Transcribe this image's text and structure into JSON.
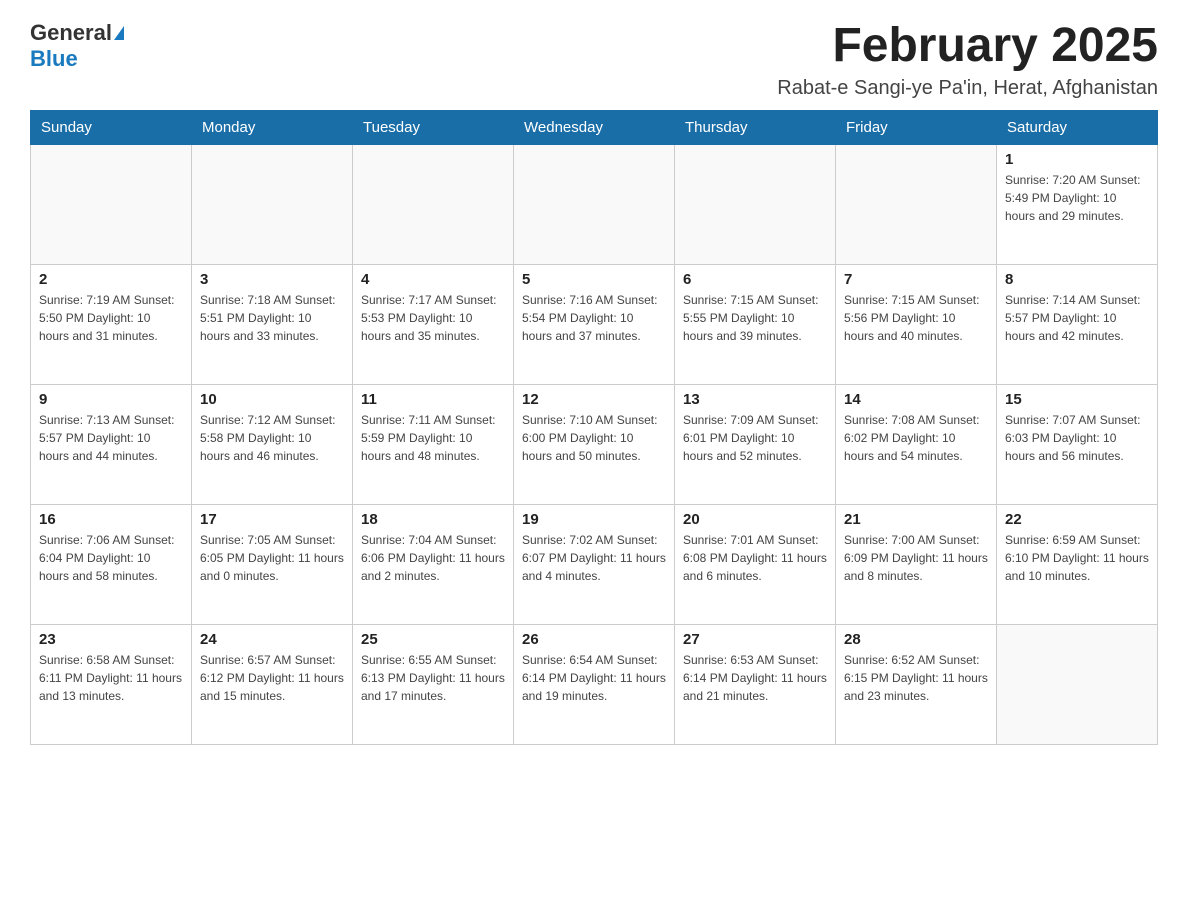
{
  "logo": {
    "general": "General",
    "blue": "Blue"
  },
  "header": {
    "month_year": "February 2025",
    "location": "Rabat-e Sangi-ye Pa'in, Herat, Afghanistan"
  },
  "weekdays": [
    "Sunday",
    "Monday",
    "Tuesday",
    "Wednesday",
    "Thursday",
    "Friday",
    "Saturday"
  ],
  "weeks": [
    [
      {
        "day": "",
        "info": ""
      },
      {
        "day": "",
        "info": ""
      },
      {
        "day": "",
        "info": ""
      },
      {
        "day": "",
        "info": ""
      },
      {
        "day": "",
        "info": ""
      },
      {
        "day": "",
        "info": ""
      },
      {
        "day": "1",
        "info": "Sunrise: 7:20 AM\nSunset: 5:49 PM\nDaylight: 10 hours and 29 minutes."
      }
    ],
    [
      {
        "day": "2",
        "info": "Sunrise: 7:19 AM\nSunset: 5:50 PM\nDaylight: 10 hours and 31 minutes."
      },
      {
        "day": "3",
        "info": "Sunrise: 7:18 AM\nSunset: 5:51 PM\nDaylight: 10 hours and 33 minutes."
      },
      {
        "day": "4",
        "info": "Sunrise: 7:17 AM\nSunset: 5:53 PM\nDaylight: 10 hours and 35 minutes."
      },
      {
        "day": "5",
        "info": "Sunrise: 7:16 AM\nSunset: 5:54 PM\nDaylight: 10 hours and 37 minutes."
      },
      {
        "day": "6",
        "info": "Sunrise: 7:15 AM\nSunset: 5:55 PM\nDaylight: 10 hours and 39 minutes."
      },
      {
        "day": "7",
        "info": "Sunrise: 7:15 AM\nSunset: 5:56 PM\nDaylight: 10 hours and 40 minutes."
      },
      {
        "day": "8",
        "info": "Sunrise: 7:14 AM\nSunset: 5:57 PM\nDaylight: 10 hours and 42 minutes."
      }
    ],
    [
      {
        "day": "9",
        "info": "Sunrise: 7:13 AM\nSunset: 5:57 PM\nDaylight: 10 hours and 44 minutes."
      },
      {
        "day": "10",
        "info": "Sunrise: 7:12 AM\nSunset: 5:58 PM\nDaylight: 10 hours and 46 minutes."
      },
      {
        "day": "11",
        "info": "Sunrise: 7:11 AM\nSunset: 5:59 PM\nDaylight: 10 hours and 48 minutes."
      },
      {
        "day": "12",
        "info": "Sunrise: 7:10 AM\nSunset: 6:00 PM\nDaylight: 10 hours and 50 minutes."
      },
      {
        "day": "13",
        "info": "Sunrise: 7:09 AM\nSunset: 6:01 PM\nDaylight: 10 hours and 52 minutes."
      },
      {
        "day": "14",
        "info": "Sunrise: 7:08 AM\nSunset: 6:02 PM\nDaylight: 10 hours and 54 minutes."
      },
      {
        "day": "15",
        "info": "Sunrise: 7:07 AM\nSunset: 6:03 PM\nDaylight: 10 hours and 56 minutes."
      }
    ],
    [
      {
        "day": "16",
        "info": "Sunrise: 7:06 AM\nSunset: 6:04 PM\nDaylight: 10 hours and 58 minutes."
      },
      {
        "day": "17",
        "info": "Sunrise: 7:05 AM\nSunset: 6:05 PM\nDaylight: 11 hours and 0 minutes."
      },
      {
        "day": "18",
        "info": "Sunrise: 7:04 AM\nSunset: 6:06 PM\nDaylight: 11 hours and 2 minutes."
      },
      {
        "day": "19",
        "info": "Sunrise: 7:02 AM\nSunset: 6:07 PM\nDaylight: 11 hours and 4 minutes."
      },
      {
        "day": "20",
        "info": "Sunrise: 7:01 AM\nSunset: 6:08 PM\nDaylight: 11 hours and 6 minutes."
      },
      {
        "day": "21",
        "info": "Sunrise: 7:00 AM\nSunset: 6:09 PM\nDaylight: 11 hours and 8 minutes."
      },
      {
        "day": "22",
        "info": "Sunrise: 6:59 AM\nSunset: 6:10 PM\nDaylight: 11 hours and 10 minutes."
      }
    ],
    [
      {
        "day": "23",
        "info": "Sunrise: 6:58 AM\nSunset: 6:11 PM\nDaylight: 11 hours and 13 minutes."
      },
      {
        "day": "24",
        "info": "Sunrise: 6:57 AM\nSunset: 6:12 PM\nDaylight: 11 hours and 15 minutes."
      },
      {
        "day": "25",
        "info": "Sunrise: 6:55 AM\nSunset: 6:13 PM\nDaylight: 11 hours and 17 minutes."
      },
      {
        "day": "26",
        "info": "Sunrise: 6:54 AM\nSunset: 6:14 PM\nDaylight: 11 hours and 19 minutes."
      },
      {
        "day": "27",
        "info": "Sunrise: 6:53 AM\nSunset: 6:14 PM\nDaylight: 11 hours and 21 minutes."
      },
      {
        "day": "28",
        "info": "Sunrise: 6:52 AM\nSunset: 6:15 PM\nDaylight: 11 hours and 23 minutes."
      },
      {
        "day": "",
        "info": ""
      }
    ]
  ]
}
